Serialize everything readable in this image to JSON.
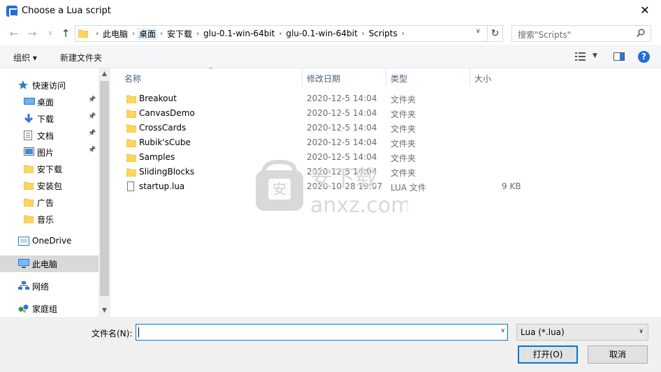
{
  "window": {
    "title": "Choose a Lua script",
    "close_label": "✕"
  },
  "address": {
    "crumbs": [
      "此电脑",
      "桌面",
      "安下载",
      "glu-0.1-win-64bit",
      "glu-0.1-win-64bit",
      "Scripts"
    ],
    "highlighted_index": 1
  },
  "search": {
    "placeholder": "搜索\"Scripts\""
  },
  "toolbar": {
    "organize": "组织 ▾",
    "new_folder": "新建文件夹"
  },
  "sidebar": {
    "items": [
      {
        "label": "快速访问",
        "icon": "star-icon"
      },
      {
        "label": "桌面",
        "icon": "desktop-icon",
        "pinned": true
      },
      {
        "label": "下载",
        "icon": "download-icon",
        "pinned": true
      },
      {
        "label": "文档",
        "icon": "document-icon",
        "pinned": true
      },
      {
        "label": "图片",
        "icon": "picture-icon",
        "pinned": true
      },
      {
        "label": "安下载",
        "icon": "folder-icon"
      },
      {
        "label": "安装包",
        "icon": "folder-icon"
      },
      {
        "label": "广告",
        "icon": "folder-icon"
      },
      {
        "label": "音乐",
        "icon": "folder-icon"
      },
      {
        "label": "OneDrive",
        "icon": "onedrive-icon"
      },
      {
        "label": "此电脑",
        "icon": "computer-icon",
        "selected": true
      },
      {
        "label": "网络",
        "icon": "network-icon"
      },
      {
        "label": "家庭组",
        "icon": "homegroup-icon"
      }
    ]
  },
  "columns": {
    "name": "名称",
    "date": "修改日期",
    "type": "类型",
    "size": "大小"
  },
  "files": [
    {
      "name": "Breakout",
      "date": "2020-12-5 14:04",
      "type": "文件夹",
      "size": "",
      "kind": "folder"
    },
    {
      "name": "CanvasDemo",
      "date": "2020-12-5 14:04",
      "type": "文件夹",
      "size": "",
      "kind": "folder"
    },
    {
      "name": "CrossCards",
      "date": "2020-12-5 14:04",
      "type": "文件夹",
      "size": "",
      "kind": "folder"
    },
    {
      "name": "Rubik'sCube",
      "date": "2020-12-5 14:04",
      "type": "文件夹",
      "size": "",
      "kind": "folder"
    },
    {
      "name": "Samples",
      "date": "2020-12-5 14:04",
      "type": "文件夹",
      "size": "",
      "kind": "folder"
    },
    {
      "name": "SlidingBlocks",
      "date": "2020-12-5 14:04",
      "type": "文件夹",
      "size": "",
      "kind": "folder"
    },
    {
      "name": "startup.lua",
      "date": "2020-10-28 19:07",
      "type": "LUA 文件",
      "size": "9 KB",
      "kind": "file"
    }
  ],
  "footer": {
    "filename_label": "文件名(N):",
    "filename_value": "",
    "filter_value": "Lua (*.lua)",
    "open_label": "打开(O)",
    "cancel_label": "取消"
  },
  "watermark": {
    "line1": "安下载",
    "line2": "anxz.com"
  },
  "colors": {
    "accent": "#0078d7",
    "folder": "#ffd65c",
    "selected_bg": "#d9d9d9"
  }
}
